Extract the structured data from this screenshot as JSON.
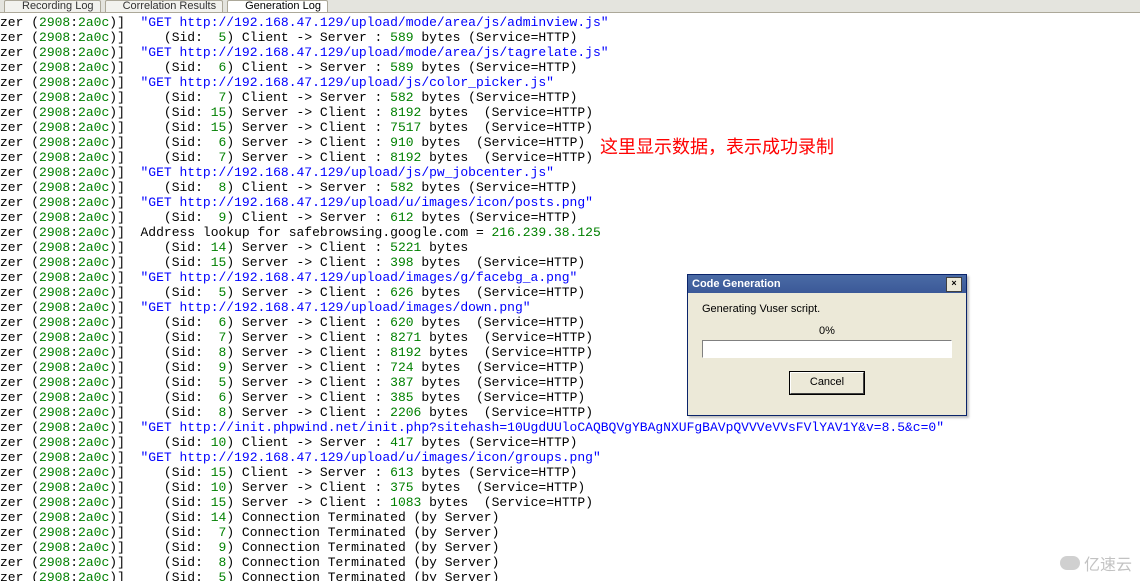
{
  "tabs": [
    {
      "label": "Recording Log",
      "icon": "record-icon"
    },
    {
      "label": "Correlation Results",
      "icon": "list-icon"
    },
    {
      "label": "Generation Log",
      "icon": "gen-icon"
    }
  ],
  "active_tab": 2,
  "prefix": {
    "zer": "zer",
    "open": " (",
    "pid": "2908",
    "sep": ":",
    "tid": "2a0c",
    "close": ")]  "
  },
  "lines": [
    {
      "type": "get",
      "url": "\"GET http://192.168.47.129/upload/mode/area/js/adminview.js\""
    },
    {
      "type": "data",
      "sid": "5",
      "dir": "Client -> Server",
      "bytes": "589",
      "svc": true
    },
    {
      "type": "get",
      "url": "\"GET http://192.168.47.129/upload/mode/area/js/tagrelate.js\""
    },
    {
      "type": "data",
      "sid": "6",
      "dir": "Client -> Server",
      "bytes": "589",
      "svc": true
    },
    {
      "type": "get",
      "url": "\"GET http://192.168.47.129/upload/js/color_picker.js\""
    },
    {
      "type": "data",
      "sid": "7",
      "dir": "Client -> Server",
      "bytes": "582",
      "svc": true
    },
    {
      "type": "data",
      "sid": "15",
      "dir": "Server -> Client",
      "bytes": "8192",
      "svc": true,
      "spaceAfterBytes": true
    },
    {
      "type": "data",
      "sid": "15",
      "dir": "Server -> Client",
      "bytes": "7517",
      "svc": true,
      "spaceAfterBytes": true
    },
    {
      "type": "data",
      "sid": "6",
      "dir": "Server -> Client",
      "bytes": "910",
      "svc": true,
      "spaceAfterBytes": true
    },
    {
      "type": "data",
      "sid": "7",
      "dir": "Server -> Client",
      "bytes": "8192",
      "svc": true,
      "spaceAfterBytes": true
    },
    {
      "type": "get",
      "url": "\"GET http://192.168.47.129/upload/js/pw_jobcenter.js\""
    },
    {
      "type": "data",
      "sid": "8",
      "dir": "Client -> Server",
      "bytes": "582",
      "svc": true
    },
    {
      "type": "get",
      "url": "\"GET http://192.168.47.129/upload/u/images/icon/posts.png\""
    },
    {
      "type": "data",
      "sid": "9",
      "dir": "Client -> Server",
      "bytes": "612",
      "svc": true
    },
    {
      "type": "addr",
      "text1": "Address lookup for safebrowsing.google.com = ",
      "ip": "216.239.38.125"
    },
    {
      "type": "data",
      "sid": "14",
      "dir": "Server -> Client",
      "bytes": "5221",
      "svc": false
    },
    {
      "type": "data",
      "sid": "15",
      "dir": "Server -> Client",
      "bytes": "398",
      "svc": true,
      "spaceAfterBytes": true
    },
    {
      "type": "get",
      "url": "\"GET http://192.168.47.129/upload/images/g/facebg_a.png\""
    },
    {
      "type": "data",
      "sid": "5",
      "dir": "Server -> Client",
      "bytes": "626",
      "svc": true,
      "spaceAfterBytes": true
    },
    {
      "type": "get",
      "url": "\"GET http://192.168.47.129/upload/images/down.png\""
    },
    {
      "type": "data",
      "sid": "6",
      "dir": "Server -> Client",
      "bytes": "620",
      "svc": true,
      "spaceAfterBytes": true
    },
    {
      "type": "data",
      "sid": "7",
      "dir": "Server -> Client",
      "bytes": "8271",
      "svc": true,
      "spaceAfterBytes": true
    },
    {
      "type": "data",
      "sid": "8",
      "dir": "Server -> Client",
      "bytes": "8192",
      "svc": true,
      "spaceAfterBytes": true
    },
    {
      "type": "data",
      "sid": "9",
      "dir": "Server -> Client",
      "bytes": "724",
      "svc": true,
      "spaceAfterBytes": true
    },
    {
      "type": "data",
      "sid": "5",
      "dir": "Server -> Client",
      "bytes": "387",
      "svc": true,
      "spaceAfterBytes": true
    },
    {
      "type": "data",
      "sid": "6",
      "dir": "Server -> Client",
      "bytes": "385",
      "svc": true,
      "spaceAfterBytes": true
    },
    {
      "type": "data",
      "sid": "8",
      "dir": "Server -> Client",
      "bytes": "2206",
      "svc": true,
      "spaceAfterBytes": true
    },
    {
      "type": "get",
      "url": "\"GET http://init.phpwind.net/init.php?sitehash=10UgdUUloCAQBQVgYBAgNXUFgBAVpQVVVeVVsFVlYAV1Y&v=8.5&c=0\""
    },
    {
      "type": "data",
      "sid": "10",
      "dir": "Client -> Server",
      "bytes": "417",
      "svc": true
    },
    {
      "type": "get",
      "url": "\"GET http://192.168.47.129/upload/u/images/icon/groups.png\""
    },
    {
      "type": "data",
      "sid": "15",
      "dir": "Client -> Server",
      "bytes": "613",
      "svc": true
    },
    {
      "type": "data",
      "sid": "10",
      "dir": "Server -> Client",
      "bytes": "375",
      "svc": true,
      "spaceAfterBytes": true
    },
    {
      "type": "data",
      "sid": "15",
      "dir": "Server -> Client",
      "bytes": "1083",
      "svc": true,
      "spaceAfterBytes": true
    },
    {
      "type": "term",
      "sid": "14"
    },
    {
      "type": "term",
      "sid": "7"
    },
    {
      "type": "term",
      "sid": "9"
    },
    {
      "type": "term",
      "sid": "8"
    },
    {
      "type": "term",
      "sid": "5",
      "partial": true
    }
  ],
  "strings": {
    "sid": "(Sid: ",
    "sid_close": ")",
    "colon": " : ",
    "bytes": " bytes",
    "svc_open": "(Service=",
    "svc_close": ")",
    "svc_val": "HTTP",
    "term": "Connection Terminated (by Server)"
  },
  "annotation": "这里显示数据，表示成功录制",
  "dialog": {
    "title": "Code Generation",
    "message": "Generating Vuser script.",
    "percent": "0%",
    "cancel": "Cancel",
    "close": "×"
  },
  "watermark": "亿速云"
}
